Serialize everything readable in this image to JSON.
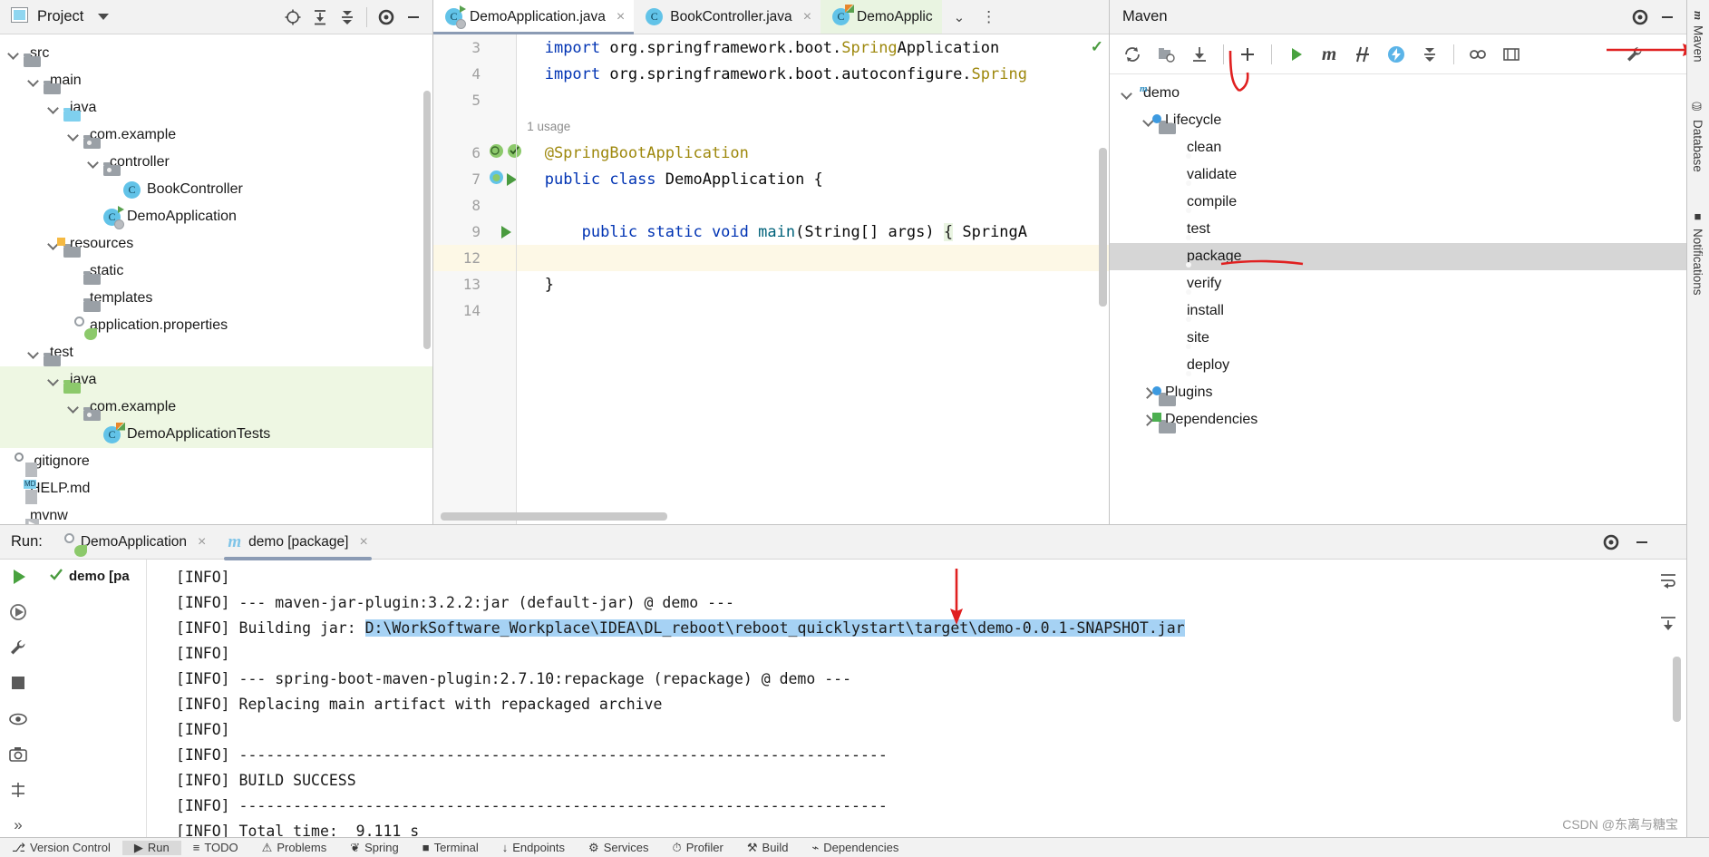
{
  "project_panel": {
    "title": "Project",
    "header_icons": [
      "locate-icon",
      "expand-all-icon",
      "collapse-all-icon",
      "gear-icon",
      "minimize-icon"
    ],
    "tree": [
      {
        "label": "src",
        "depth": 1,
        "icon": "folder-gray",
        "arrow": "down",
        "scope": "none"
      },
      {
        "label": "main",
        "depth": 2,
        "icon": "folder-gray",
        "arrow": "down",
        "scope": "none"
      },
      {
        "label": "java",
        "depth": 3,
        "icon": "folder-blue",
        "arrow": "down",
        "scope": "none"
      },
      {
        "label": "com.example",
        "depth": 4,
        "icon": "package-icon",
        "arrow": "down",
        "scope": "none"
      },
      {
        "label": "controller",
        "depth": 5,
        "icon": "package-icon",
        "arrow": "down",
        "scope": "none"
      },
      {
        "label": "BookController",
        "depth": 6,
        "icon": "java-class-icon",
        "arrow": "none",
        "scope": "none"
      },
      {
        "label": "DemoApplication",
        "depth": 5,
        "icon": "spring-boot-class-icon",
        "arrow": "none",
        "scope": "none"
      },
      {
        "label": "resources",
        "depth": 3,
        "icon": "folder-resources",
        "arrow": "down",
        "scope": "none"
      },
      {
        "label": "static",
        "depth": 4,
        "icon": "folder-gray",
        "arrow": "none",
        "scope": "none"
      },
      {
        "label": "templates",
        "depth": 4,
        "icon": "folder-gray",
        "arrow": "none",
        "scope": "none"
      },
      {
        "label": "application.properties",
        "depth": 4,
        "icon": "spring-properties-icon",
        "arrow": "none",
        "scope": "none"
      },
      {
        "label": "test",
        "depth": 2,
        "icon": "folder-gray",
        "arrow": "down",
        "scope": "none"
      },
      {
        "label": "java",
        "depth": 3,
        "icon": "folder-green",
        "arrow": "down",
        "scope": "test"
      },
      {
        "label": "com.example",
        "depth": 4,
        "icon": "package-icon",
        "arrow": "down",
        "scope": "test"
      },
      {
        "label": "DemoApplicationTests",
        "depth": 5,
        "icon": "java-test-class-icon",
        "arrow": "none",
        "scope": "test"
      },
      {
        "label": ".gitignore",
        "depth": 1,
        "icon": "gitignore-icon",
        "arrow": "none",
        "scope": "none"
      },
      {
        "label": "HELP.md",
        "depth": 1,
        "icon": "markdown-icon",
        "arrow": "none",
        "scope": "none"
      },
      {
        "label": "mvnw",
        "depth": 1,
        "icon": "shell-script-icon",
        "arrow": "none",
        "scope": "none"
      }
    ]
  },
  "editor": {
    "tabs": [
      {
        "label": "DemoApplication.java",
        "icon": "spring-boot-class-icon",
        "active": true,
        "closable": true
      },
      {
        "label": "BookController.java",
        "icon": "java-class-icon",
        "active": false,
        "closable": true
      },
      {
        "label": "DemoApplic",
        "icon": "java-test-class-icon",
        "active": false,
        "closable": false
      }
    ],
    "tab_overflow_icon": "chevron-down-icon",
    "tab_more_icon": "more-options-icon",
    "inspection_status_icon": "check-ok-icon",
    "usage_hint": "1 usage",
    "lines": [
      {
        "num": "3",
        "text": "import org.springframework.boot.SpringApplication",
        "kind": "import",
        "highlight": false
      },
      {
        "num": "4",
        "text": "import org.springframework.boot.autoconfigure.Spring",
        "kind": "import",
        "highlight": false
      },
      {
        "num": "5",
        "text": "",
        "kind": "blank",
        "highlight": false
      },
      {
        "num": "",
        "text": "1 usage",
        "kind": "usage",
        "highlight": false
      },
      {
        "num": "6",
        "text": "@SpringBootApplication",
        "kind": "annotation",
        "highlight": false
      },
      {
        "num": "7",
        "text": "public class DemoApplication {",
        "kind": "class",
        "highlight": false
      },
      {
        "num": "8",
        "text": "",
        "kind": "blank",
        "highlight": false
      },
      {
        "num": "9",
        "text": "    public static void main(String[] args) { SpringA",
        "kind": "method",
        "highlight": false
      },
      {
        "num": "12",
        "text": "",
        "kind": "blank",
        "highlight": true
      },
      {
        "num": "13",
        "text": "}",
        "kind": "plain",
        "highlight": false
      },
      {
        "num": "14",
        "text": "",
        "kind": "blank",
        "highlight": false
      }
    ]
  },
  "maven": {
    "title": "Maven",
    "toolbar_icons": [
      "reload-all-projects-icon",
      "add-maven-project-icon",
      "download-sources-icon",
      "add-icon",
      "run-icon",
      "maven-goal-icon",
      "skip-tests-icon",
      "toggle-offline-icon",
      "expand-all-icon",
      "profiles-icon",
      "show-diagram-icon",
      "settings-wrench-icon",
      "minimize-icon"
    ],
    "tree": [
      {
        "label": "demo",
        "depth": 0,
        "icon": "maven-project-icon",
        "arrow": "down",
        "selected": false
      },
      {
        "label": "Lifecycle",
        "depth": 1,
        "icon": "lifecycle-folder-icon",
        "arrow": "down",
        "selected": false
      },
      {
        "label": "clean",
        "depth": 2,
        "icon": "maven-goal-gear-icon",
        "arrow": "none",
        "selected": false
      },
      {
        "label": "validate",
        "depth": 2,
        "icon": "maven-goal-gear-icon",
        "arrow": "none",
        "selected": false
      },
      {
        "label": "compile",
        "depth": 2,
        "icon": "maven-goal-gear-icon",
        "arrow": "none",
        "selected": false
      },
      {
        "label": "test",
        "depth": 2,
        "icon": "maven-goal-gear-icon",
        "arrow": "none",
        "selected": false
      },
      {
        "label": "package",
        "depth": 2,
        "icon": "maven-goal-gear-icon",
        "arrow": "none",
        "selected": true
      },
      {
        "label": "verify",
        "depth": 2,
        "icon": "maven-goal-gear-icon",
        "arrow": "none",
        "selected": false
      },
      {
        "label": "install",
        "depth": 2,
        "icon": "maven-goal-gear-icon",
        "arrow": "none",
        "selected": false
      },
      {
        "label": "site",
        "depth": 2,
        "icon": "maven-goal-gear-icon",
        "arrow": "none",
        "selected": false
      },
      {
        "label": "deploy",
        "depth": 2,
        "icon": "maven-goal-gear-icon",
        "arrow": "none",
        "selected": false
      },
      {
        "label": "Plugins",
        "depth": 1,
        "icon": "plugins-folder-icon",
        "arrow": "right",
        "selected": false
      },
      {
        "label": "Dependencies",
        "depth": 1,
        "icon": "dependencies-folder-icon",
        "arrow": "right",
        "selected": false
      }
    ]
  },
  "run_panel": {
    "label": "Run:",
    "tabs": [
      {
        "label": "DemoApplication",
        "icon": "spring-boot-run-icon",
        "active": false,
        "closable": true
      },
      {
        "label": "demo [package]",
        "icon": "maven-m-icon",
        "active": true,
        "closable": true
      }
    ],
    "left_toolbar_icons": [
      "rerun-icon",
      "rerun-failed-icon",
      "settings-wrench-icon",
      "stop-icon",
      "eye-icon",
      "camera-icon",
      "thread-dump-icon",
      "expand-icon"
    ],
    "right_toolbar_icons": [
      "soft-wrap-icon",
      "scroll-to-end-icon"
    ],
    "tree_item": {
      "label": "demo [pa",
      "icon": "check-success-icon"
    },
    "console_lines": [
      {
        "text": "[INFO] ",
        "segments": [
          {
            "t": "[INFO] ",
            "hl": false
          }
        ]
      },
      {
        "text": "[INFO] --- maven-jar-plugin:3.2.2:jar (default-jar) @ demo ---",
        "segments": [
          {
            "t": "[INFO] --- maven-jar-plugin:3.2.2:jar (default-jar) @ demo ---",
            "hl": false
          }
        ]
      },
      {
        "text": "[INFO] Building jar: D:\\WorkSoftware_Workplace\\IDEA\\DL_reboot\\reboot_quicklystart\\target\\demo-0.0.1-SNAPSHOT.jar",
        "segments": [
          {
            "t": "[INFO] Building jar: ",
            "hl": false
          },
          {
            "t": "D:\\WorkSoftware_Workplace\\IDEA\\DL_reboot\\reboot_quicklystart\\target\\demo-0.0.1-SNAPSHOT.jar",
            "hl": true
          }
        ]
      },
      {
        "text": "[INFO] ",
        "segments": [
          {
            "t": "[INFO] ",
            "hl": false
          }
        ]
      },
      {
        "text": "[INFO] --- spring-boot-maven-plugin:2.7.10:repackage (repackage) @ demo ---",
        "segments": [
          {
            "t": "[INFO] --- spring-boot-maven-plugin:2.7.10:repackage (repackage) @ demo ---",
            "hl": false
          }
        ]
      },
      {
        "text": "[INFO] Replacing main artifact with repackaged archive",
        "segments": [
          {
            "t": "[INFO] Replacing main artifact with repackaged archive",
            "hl": false
          }
        ]
      },
      {
        "text": "[INFO] ",
        "segments": [
          {
            "t": "[INFO] ",
            "hl": false
          }
        ]
      },
      {
        "text": "[INFO] ------------------------------------------------------------------------",
        "segments": [
          {
            "t": "[INFO] ------------------------------------------------------------------------",
            "hl": false
          }
        ]
      },
      {
        "text": "[INFO] BUILD SUCCESS",
        "segments": [
          {
            "t": "[INFO] BUILD SUCCESS",
            "hl": false
          }
        ]
      },
      {
        "text": "[INFO] ------------------------------------------------------------------------",
        "segments": [
          {
            "t": "[INFO] ------------------------------------------------------------------------",
            "hl": false
          }
        ]
      },
      {
        "text": "[INFO] Total time:  9.111 s",
        "segments": [
          {
            "t": "[INFO] Total time:  9.111 s",
            "hl": false
          }
        ]
      }
    ]
  },
  "right_tool_strip": [
    {
      "label": "Maven",
      "icon": "maven-m-icon"
    },
    {
      "label": "Database",
      "icon": "database-icon"
    },
    {
      "label": "Notifications",
      "icon": "bell-icon"
    }
  ],
  "status_bar": [
    {
      "label": "Version Control",
      "icon": "version-control-icon",
      "selected": false
    },
    {
      "label": "Run",
      "icon": "run-icon",
      "selected": true
    },
    {
      "label": "TODO",
      "icon": "todo-icon",
      "selected": false
    },
    {
      "label": "Problems",
      "icon": "problems-icon",
      "selected": false
    },
    {
      "label": "Spring",
      "icon": "spring-icon",
      "selected": false
    },
    {
      "label": "Terminal",
      "icon": "terminal-icon",
      "selected": false
    },
    {
      "label": "Endpoints",
      "icon": "endpoints-icon",
      "selected": false
    },
    {
      "label": "Services",
      "icon": "services-icon",
      "selected": false
    },
    {
      "label": "Profiler",
      "icon": "profiler-icon",
      "selected": false
    },
    {
      "label": "Build",
      "icon": "build-icon",
      "selected": false
    },
    {
      "label": "Dependencies",
      "icon": "dependencies-icon",
      "selected": false
    }
  ],
  "annotations": {
    "arrow_maven_toolbar": "red-arrow-right",
    "arrow_lifecycle": "red-arrow-down",
    "arrow_console_path": "red-arrow-down",
    "underline_package": "red-underline"
  },
  "watermark": "CSDN @东离与糖宝",
  "colors": {
    "accent_blue": "#3d9ae0",
    "keyword_blue": "#0033b3",
    "annotation_gold": "#9e880d",
    "selection_blue": "#a6d2f4",
    "test_scope_green": "#eef7e3",
    "annotation_red": "#e02020",
    "highlight_yellow": "#fdf8e6"
  }
}
